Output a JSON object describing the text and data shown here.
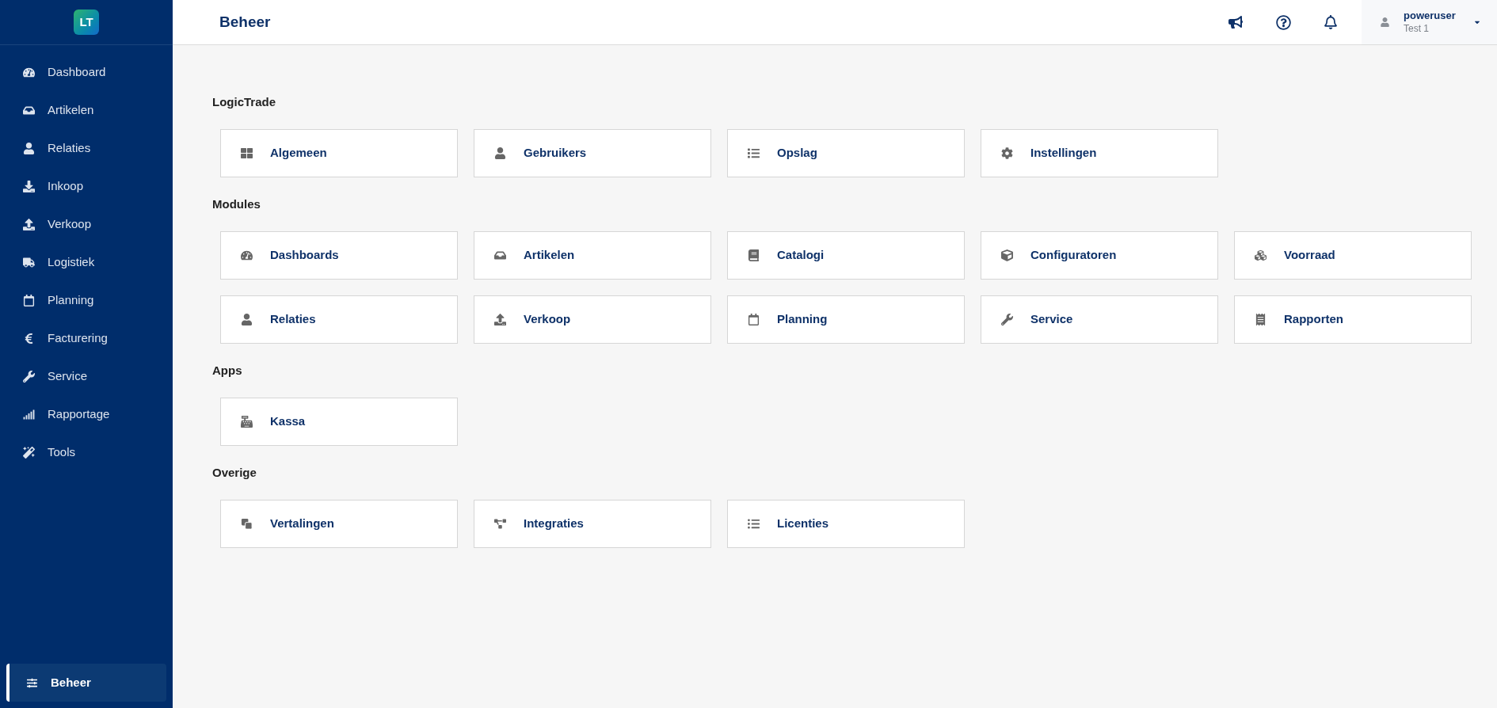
{
  "logo": {
    "text": "LT"
  },
  "sidebar": {
    "items": [
      {
        "label": "Dashboard",
        "selected": false
      },
      {
        "label": "Artikelen",
        "selected": false
      },
      {
        "label": "Relaties",
        "selected": false
      },
      {
        "label": "Inkoop",
        "selected": false
      },
      {
        "label": "Verkoop",
        "selected": false
      },
      {
        "label": "Logistiek",
        "selected": false
      },
      {
        "label": "Planning",
        "selected": false
      },
      {
        "label": "Facturering",
        "selected": false
      },
      {
        "label": "Service",
        "selected": false
      },
      {
        "label": "Rapportage",
        "selected": false
      },
      {
        "label": "Tools",
        "selected": false
      }
    ],
    "bottom_item": {
      "label": "Beheer",
      "selected": true
    }
  },
  "header": {
    "title": "Beheer",
    "user": {
      "name": "poweruser",
      "subtitle": "Test 1"
    }
  },
  "sections": [
    {
      "title": "LogicTrade",
      "tiles": [
        "Algemeen",
        "Gebruikers",
        "Opslag",
        "Instellingen"
      ]
    },
    {
      "title": "Modules",
      "tiles": [
        "Dashboards",
        "Artikelen",
        "Catalogi",
        "Configuratoren",
        "Voorraad",
        "Relaties",
        "Verkoop",
        "Planning",
        "Service",
        "Rapporten"
      ]
    },
    {
      "title": "Apps",
      "tiles": [
        "Kassa"
      ]
    },
    {
      "title": "Overige",
      "tiles": [
        "Vertalingen",
        "Integraties",
        "Licenties"
      ]
    }
  ]
}
